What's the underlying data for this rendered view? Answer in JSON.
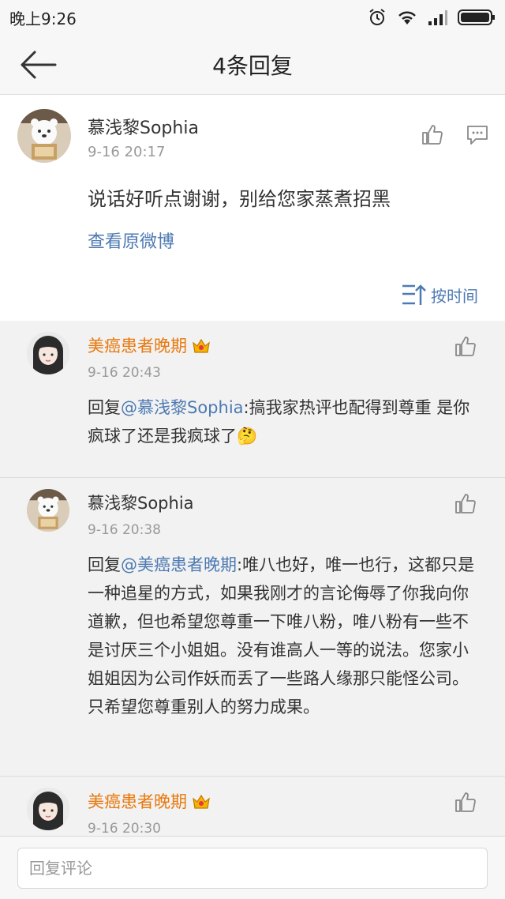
{
  "status": {
    "time": "晚上9:26"
  },
  "nav": {
    "title": "4条回复"
  },
  "root": {
    "username": "慕浅黎Sophia",
    "time": "9-16 20:17",
    "text": "说话好听点谢谢，别给您家蒸煮招黑",
    "view_original": "查看原微博",
    "sort_label": "按时间"
  },
  "replies": [
    {
      "username": "美癌患者晚期",
      "vip": true,
      "time": "9-16 20:43",
      "prefix": "回复",
      "mention": "@慕浅黎Sophia",
      "text": ":搞我家热评也配得到尊重 是你疯球了还是我疯球了",
      "emoji": "🤔"
    },
    {
      "username": "慕浅黎Sophia",
      "vip": false,
      "time": "9-16 20:38",
      "prefix": "回复",
      "mention": "@美癌患者晚期",
      "text": ":唯八也好，唯一也行，这都只是一种追星的方式，如果我刚才的言论侮辱了你我向你道歉，但也希望您尊重一下唯八粉，唯八粉有一些不是讨厌三个小姐姐。没有谁高人一等的说法。您家小姐姐因为公司作妖而丢了一些路人缘那只能怪公司。只希望您尊重别人的努力成果。"
    },
    {
      "username": "美癌患者晚期",
      "vip": true,
      "time": "9-16 20:30"
    }
  ],
  "input": {
    "placeholder": "回复评论"
  },
  "icons": {
    "back": "back-arrow-icon",
    "like": "thumbs-up-icon",
    "comment": "comment-icon",
    "sort": "sort-icon",
    "crown": "crown-icon"
  },
  "colors": {
    "link": "#4d7ab3",
    "vip_name": "#e8780c"
  }
}
